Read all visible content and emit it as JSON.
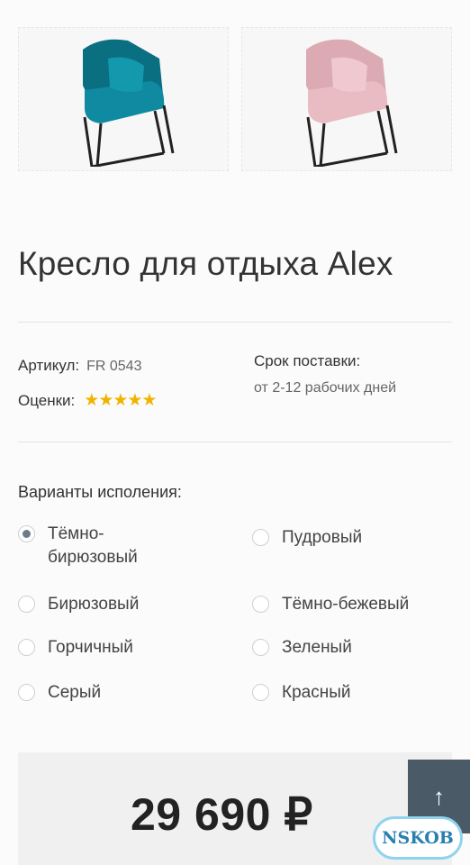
{
  "product": {
    "title": "Кресло для отдыха Alex",
    "images": [
      {
        "color_name": "teal",
        "fill": "#0f7e92"
      },
      {
        "color_name": "powder",
        "fill": "#e6b8c0"
      }
    ],
    "sku_label": "Артикул:",
    "sku_value": "FR 0543",
    "rating_label": "Оценки:",
    "rating_stars": "★★★★★",
    "rating_value": 5,
    "delivery_label": "Срок поставки:",
    "delivery_value": "от 2-12 рабочих дней"
  },
  "variants": {
    "title": "Варианты исполения:",
    "left": [
      {
        "label": "Тёмно-\nбирюзовый",
        "checked": true
      },
      {
        "label": "Бирюзовый",
        "checked": false
      },
      {
        "label": "Горчичный",
        "checked": false
      },
      {
        "label": "Серый",
        "checked": false
      }
    ],
    "right": [
      {
        "label": "Пудровый",
        "checked": false
      },
      {
        "label": "Тёмно-бежевый",
        "checked": false
      },
      {
        "label": "Зеленый",
        "checked": false
      },
      {
        "label": "Красный",
        "checked": false
      }
    ]
  },
  "price": "29 690 ₽",
  "scroll_up": "↑",
  "watermark": "NSKOB",
  "colors": {
    "accent": "#4a5a67",
    "stars": "#f0b400"
  }
}
